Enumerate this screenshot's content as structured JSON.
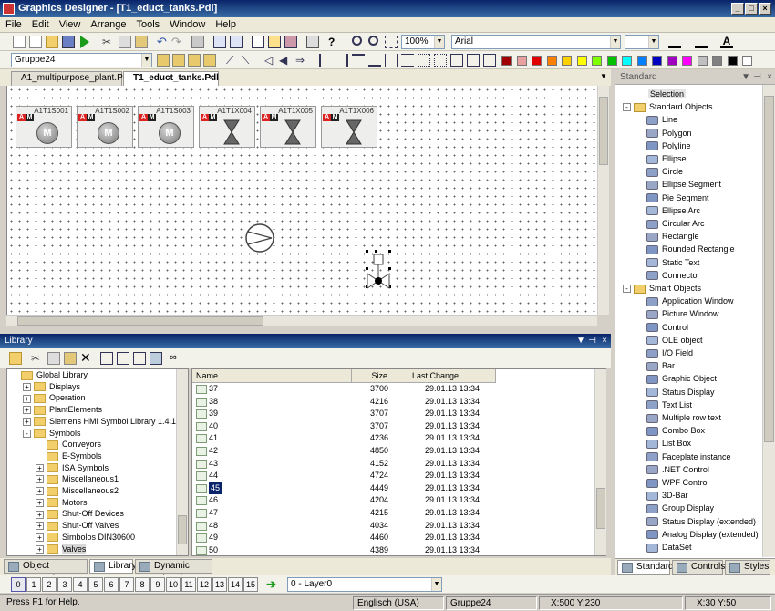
{
  "window": {
    "title": "Graphics Designer - [T1_educt_tanks.Pdl]"
  },
  "menu": [
    "File",
    "Edit",
    "View",
    "Arrange",
    "Tools",
    "Window",
    "Help"
  ],
  "toolbar": {
    "zoom": "100%",
    "font": "Arial",
    "group": "Gruppe24"
  },
  "palette": [
    "#a00000",
    "#e8a0a0",
    "#e00000",
    "#ff8000",
    "#ffd000",
    "#ffff00",
    "#80ff00",
    "#00c000",
    "#00ffff",
    "#0080ff",
    "#0000c0",
    "#a000c0",
    "#ff00ff",
    "#c0c0c0",
    "#808080",
    "#000000",
    "#ffffff"
  ],
  "doc_tabs": [
    "A1_multipurpose_plant.Pdl",
    "T1_educt_tanks.Pdl"
  ],
  "canvas_objects": [
    {
      "label": "A1T1S001",
      "kind": "motor",
      "text": "M"
    },
    {
      "label": "A1T1S002",
      "kind": "motor",
      "text": "M"
    },
    {
      "label": "A1T1S003",
      "kind": "motor",
      "text": "M"
    },
    {
      "label": "A1T1X004",
      "kind": "valve"
    },
    {
      "label": "A1T1X005",
      "kind": "valve"
    },
    {
      "label": "A1T1X006",
      "kind": "valve"
    }
  ],
  "badges": {
    "a": "A",
    "m": "M"
  },
  "library": {
    "title": "Library",
    "tree": [
      {
        "label": "Global Library",
        "level": 0,
        "exp": ""
      },
      {
        "label": "Displays",
        "level": 1,
        "exp": "+"
      },
      {
        "label": "Operation",
        "level": 1,
        "exp": "+"
      },
      {
        "label": "PlantElements",
        "level": 1,
        "exp": "+"
      },
      {
        "label": "Siemens HMI Symbol Library 1.4.1",
        "level": 1,
        "exp": "+"
      },
      {
        "label": "Symbols",
        "level": 1,
        "exp": "-"
      },
      {
        "label": "Conveyors",
        "level": 2,
        "exp": ""
      },
      {
        "label": "E-Symbols",
        "level": 2,
        "exp": ""
      },
      {
        "label": "ISA Symbols",
        "level": 2,
        "exp": "+"
      },
      {
        "label": "Miscellaneous1",
        "level": 2,
        "exp": "+"
      },
      {
        "label": "Miscellaneous2",
        "level": 2,
        "exp": "+"
      },
      {
        "label": "Motors",
        "level": 2,
        "exp": "+"
      },
      {
        "label": "Shut-Off Devices",
        "level": 2,
        "exp": "+"
      },
      {
        "label": "Shut-Off Valves",
        "level": 2,
        "exp": "+"
      },
      {
        "label": "Simbolos DIN30600",
        "level": 2,
        "exp": "+"
      },
      {
        "label": "Valves",
        "level": 2,
        "exp": "+"
      }
    ],
    "columns": [
      "Name",
      "Size",
      "Last Change"
    ],
    "files": [
      {
        "name": "37",
        "size": "3700",
        "date": "29.01.13 13:34"
      },
      {
        "name": "38",
        "size": "4216",
        "date": "29.01.13 13:34"
      },
      {
        "name": "39",
        "size": "3707",
        "date": "29.01.13 13:34"
      },
      {
        "name": "40",
        "size": "3707",
        "date": "29.01.13 13:34"
      },
      {
        "name": "41",
        "size": "4236",
        "date": "29.01.13 13:34"
      },
      {
        "name": "42",
        "size": "4850",
        "date": "29.01.13 13:34"
      },
      {
        "name": "43",
        "size": "4152",
        "date": "29.01.13 13:34"
      },
      {
        "name": "44",
        "size": "4724",
        "date": "29.01.13 13:34"
      },
      {
        "name": "45",
        "size": "4449",
        "date": "29.01.13 13:34"
      },
      {
        "name": "46",
        "size": "4204",
        "date": "29.01.13 13:34"
      },
      {
        "name": "47",
        "size": "4215",
        "date": "29.01.13 13:34"
      },
      {
        "name": "48",
        "size": "4034",
        "date": "29.01.13 13:34"
      },
      {
        "name": "49",
        "size": "4460",
        "date": "29.01.13 13:34"
      },
      {
        "name": "50",
        "size": "4389",
        "date": "29.01.13 13:34"
      }
    ],
    "selected_file": "45"
  },
  "bottom_tabs": [
    "Object Properties",
    "Library",
    "Dynamic Wizard"
  ],
  "layers": [
    "0",
    "1",
    "2",
    "3",
    "4",
    "5",
    "6",
    "7",
    "8",
    "9",
    "10",
    "11",
    "12",
    "13",
    "14",
    "15"
  ],
  "layer_select": "0 - Layer0",
  "status": {
    "help": "Press F1 for Help.",
    "lang": "Englisch (USA)",
    "object": "Gruppe24",
    "pos": "X:500 Y:230",
    "size": "X:30 Y:50"
  },
  "standard_panel": {
    "title": "Standard",
    "selection": "Selection",
    "groups": [
      {
        "label": "Standard Objects",
        "items": [
          "Line",
          "Polygon",
          "Polyline",
          "Ellipse",
          "Circle",
          "Ellipse Segment",
          "Pie Segment",
          "Ellipse Arc",
          "Circular Arc",
          "Rectangle",
          "Rounded Rectangle",
          "Static Text",
          "Connector"
        ]
      },
      {
        "label": "Smart Objects",
        "items": [
          "Application Window",
          "Picture Window",
          "Control",
          "OLE object",
          "I/O Field",
          "Bar",
          "Graphic Object",
          "Status Display",
          "Text List",
          "Multiple row text",
          "Combo Box",
          "List Box",
          "Faceplate instance",
          ".NET Control",
          "WPF Control",
          "3D-Bar",
          "Group Display",
          "Status Display (extended)",
          "Analog Display (extended)",
          "DataSet"
        ]
      }
    ],
    "tabs": [
      "Standard",
      "Controls",
      "Styles"
    ]
  }
}
